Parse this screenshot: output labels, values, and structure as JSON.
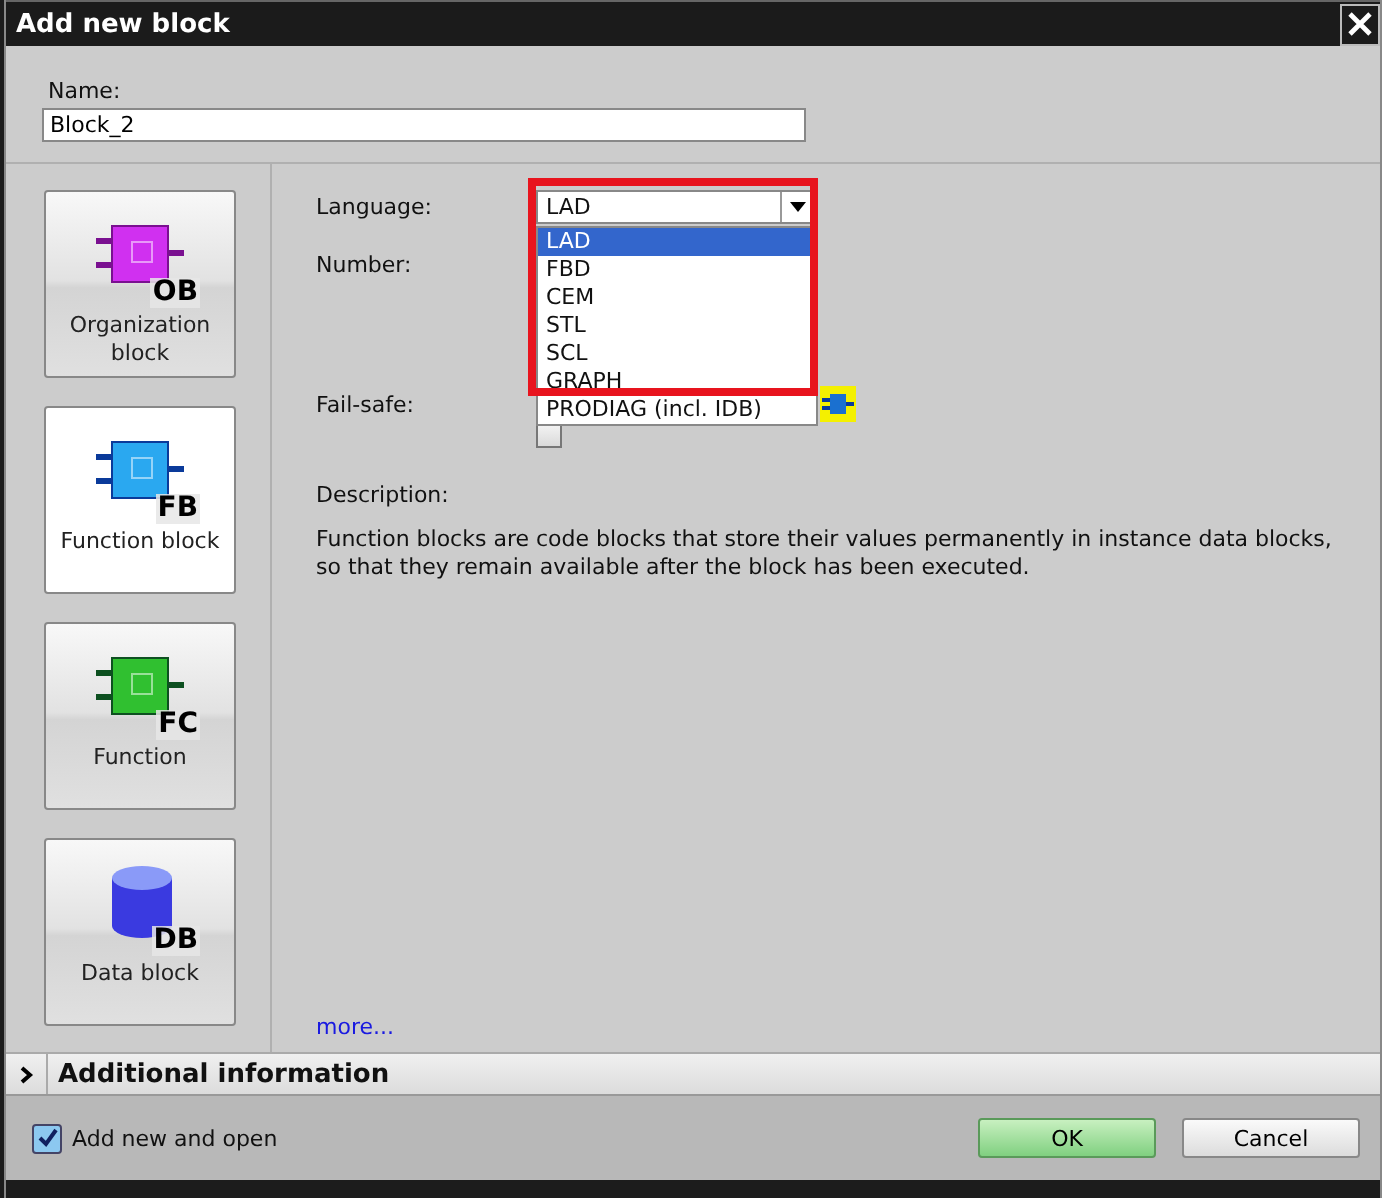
{
  "window": {
    "title": "Add new block"
  },
  "name_field": {
    "label": "Name:",
    "value": "Block_2"
  },
  "block_types": [
    {
      "kind": "ob",
      "badge": "OB",
      "label": "Organization block",
      "selected": false
    },
    {
      "kind": "fb",
      "badge": "FB",
      "label": "Function block",
      "selected": true
    },
    {
      "kind": "fc",
      "badge": "FC",
      "label": "Function",
      "selected": false
    },
    {
      "kind": "db",
      "badge": "DB",
      "label": "Data block",
      "selected": false
    }
  ],
  "language": {
    "label": "Language:",
    "value": "LAD",
    "options": [
      {
        "label": "LAD",
        "selected": true
      },
      {
        "label": "FBD",
        "selected": false
      },
      {
        "label": "CEM",
        "selected": false
      },
      {
        "label": "STL",
        "selected": false
      },
      {
        "label": "SCL",
        "selected": false
      },
      {
        "label": "GRAPH",
        "selected": false
      },
      {
        "label": "PRODIAG (incl. IDB)",
        "selected": false
      }
    ]
  },
  "number": {
    "label": "Number:"
  },
  "fail_safe": {
    "label": "Fail-safe:",
    "checked": false
  },
  "description": {
    "label": "Description:",
    "text": "Function blocks are code blocks that store their values permanently in instance data blocks, so that they remain available after the block has been executed."
  },
  "more_link": "more...",
  "additional_information": {
    "label": "Additional information",
    "expanded": false
  },
  "add_new_and_open": {
    "label": "Add new and open",
    "checked": true
  },
  "buttons": [
    {
      "kind": "primary",
      "label": "OK"
    },
    {
      "kind": "normal",
      "label": "Cancel"
    }
  ]
}
